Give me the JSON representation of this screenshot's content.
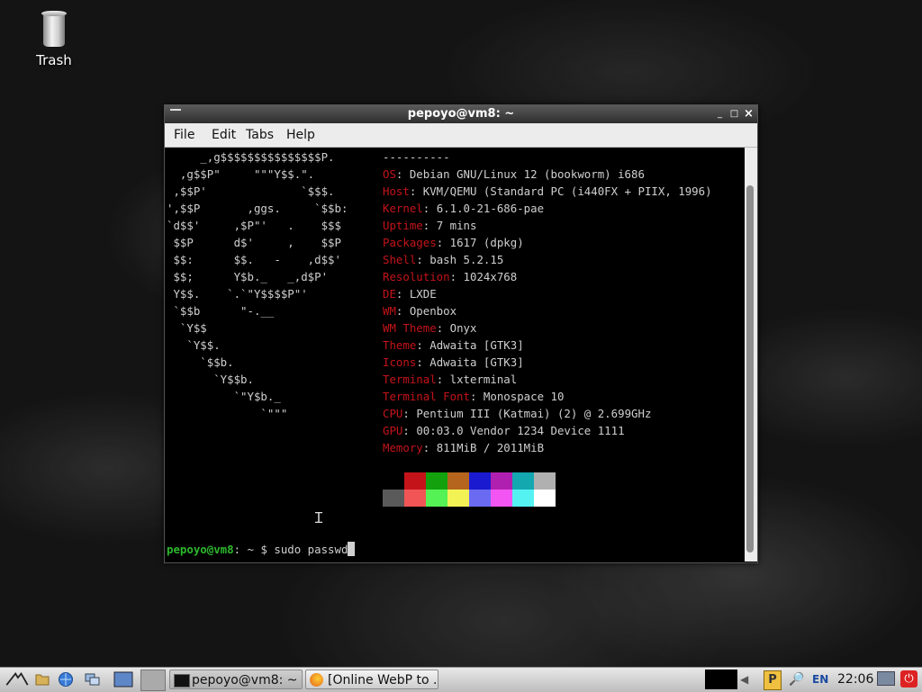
{
  "desktop": {
    "trash_label": "Trash"
  },
  "window": {
    "title": "pepoyo@vm8: ~",
    "controls": {
      "minimize": "_",
      "maximize": "□",
      "close": "×"
    },
    "menu": [
      "File",
      "Edit",
      "Tabs",
      "Help"
    ]
  },
  "terminal": {
    "logo_lines": [
      "     _,g$$$$$$$$$$$$$$$P.",
      "  ,g$$P\"     \"\"\"Y$$.\".",
      " ,$$P'              `$$$.",
      "',$$P       ,ggs.     `$$b:",
      "`d$$'     ,$P\"'   .    $$$",
      " $$P      d$'     ,    $$P",
      " $$:      $$.   -    ,d$$'",
      " $$;      Y$b._   _,d$P'",
      " Y$$.    `.`\"Y$$$$P\"'",
      " `$$b      \"-.__",
      "  `Y$$",
      "   `Y$$.",
      "     `$$b.",
      "       `Y$$b.",
      "          `\"Y$b._",
      "              `\"\"\""
    ],
    "separator": "----------",
    "info": [
      {
        "key": "OS",
        "value": "Debian GNU/Linux 12 (bookworm) i686"
      },
      {
        "key": "Host",
        "value": "KVM/QEMU (Standard PC (i440FX + PIIX, 1996)"
      },
      {
        "key": "Kernel",
        "value": "6.1.0-21-686-pae"
      },
      {
        "key": "Uptime",
        "value": "7 mins"
      },
      {
        "key": "Packages",
        "value": "1617 (dpkg)"
      },
      {
        "key": "Shell",
        "value": "bash 5.2.15"
      },
      {
        "key": "Resolution",
        "value": "1024x768"
      },
      {
        "key": "DE",
        "value": "LXDE"
      },
      {
        "key": "WM",
        "value": "Openbox"
      },
      {
        "key": "WM Theme",
        "value": "Onyx"
      },
      {
        "key": "Theme",
        "value": "Adwaita [GTK3]"
      },
      {
        "key": "Icons",
        "value": "Adwaita [GTK3]"
      },
      {
        "key": "Terminal",
        "value": "lxterminal"
      },
      {
        "key": "Terminal Font",
        "value": "Monospace 10"
      },
      {
        "key": "CPU",
        "value": "Pentium III (Katmai) (2) @ 2.699GHz"
      },
      {
        "key": "GPU",
        "value": "00:03.0 Vendor 1234 Device 1111"
      },
      {
        "key": "Memory",
        "value": "811MiB / 2011MiB"
      }
    ],
    "palette_row1": [
      "#000000",
      "#c4141a",
      "#13a10e",
      "#b5651d",
      "#1a1ad0",
      "#b020b0",
      "#13a7b0",
      "#b0b0b0"
    ],
    "palette_row2": [
      "#5a5a5a",
      "#f25555",
      "#55f255",
      "#f2f255",
      "#6a6af2",
      "#f255f2",
      "#55f2f2",
      "#ffffff"
    ],
    "prompt_user": "pepoyo@vm8",
    "prompt_rest": ": ~ $ ",
    "command": "sudo passwd"
  },
  "taskbar": {
    "tasks": [
      {
        "label": "pepoyo@vm8: ~",
        "active": true
      },
      {
        "label": "[Online WebP to ...",
        "active": false
      }
    ],
    "lang": "EN",
    "clock": "22:06"
  }
}
